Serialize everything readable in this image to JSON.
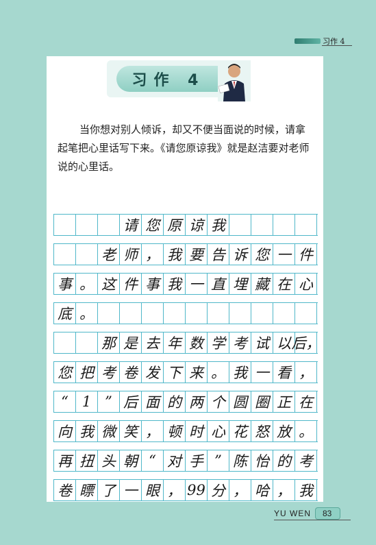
{
  "header": {
    "section_label": "习作 4"
  },
  "banner": {
    "title": "习作 4"
  },
  "intro": {
    "paragraph": "当你想对别人倾诉，却又不便当面说的时候，请拿起笔把心里话写下来。《请您原谅我》就是赵洁要对老师说的心里话。"
  },
  "grid": {
    "rows": [
      [
        "",
        "",
        "",
        "请",
        "您",
        "原",
        "谅",
        "我",
        "",
        "",
        "",
        ""
      ],
      [
        "",
        "",
        "老",
        "师",
        "，",
        "我",
        "要",
        "告",
        "诉",
        "您",
        "一",
        "件"
      ],
      [
        "事",
        "。",
        "这",
        "件",
        "事",
        "我",
        "一",
        "直",
        "埋",
        "藏",
        "在",
        "心"
      ],
      [
        "底",
        "。",
        "",
        "",
        "",
        "",
        "",
        "",
        "",
        "",
        "",
        ""
      ],
      [
        "",
        "",
        "那",
        "是",
        "去",
        "年",
        "数",
        "学",
        "考",
        "试",
        "以",
        "后，"
      ],
      [
        "您",
        "把",
        "考",
        "卷",
        "发",
        "下",
        "来",
        "。",
        "我",
        "一",
        "看",
        "，"
      ],
      [
        "“",
        "1",
        "”",
        "后",
        "面",
        "的",
        "两",
        "个",
        "圆",
        "圈",
        "正",
        "在"
      ],
      [
        "向",
        "我",
        "微",
        "笑",
        "，",
        "顿",
        "时",
        "心",
        "花",
        "怒",
        "放",
        "。"
      ],
      [
        "再",
        "扭",
        "头",
        "朝",
        "“",
        "对",
        "手",
        "”",
        "陈",
        "怡",
        "的",
        "考"
      ],
      [
        "卷",
        "瞟",
        "了",
        "一",
        "眼",
        "，",
        "99",
        "分",
        "，",
        "哈",
        "，",
        "我"
      ]
    ]
  },
  "footer": {
    "book_label": "YU WEN",
    "page_number": "83"
  }
}
